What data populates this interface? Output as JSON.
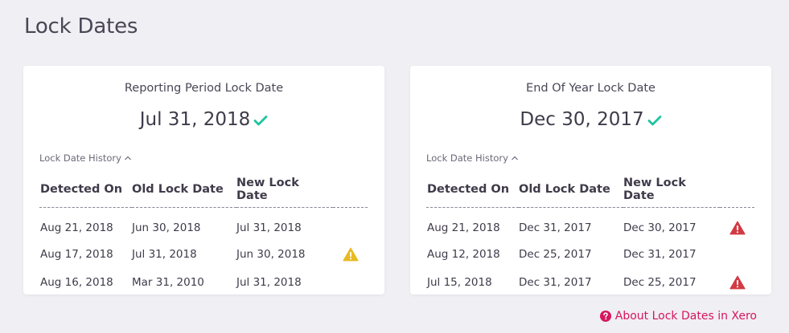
{
  "page": {
    "title": "Lock Dates"
  },
  "colors": {
    "accent": "#d6165e",
    "success": "#1ec3a0",
    "warning": "#e8b923",
    "danger": "#d23a44"
  },
  "cards": [
    {
      "title": "Reporting Period Lock Date",
      "date": "Jul 31, 2018",
      "history_label": "Lock Date History",
      "columns": [
        "Detected On",
        "Old Lock Date",
        "New Lock Date"
      ],
      "rows": [
        {
          "detected": "Aug 21, 2018",
          "old": "Jun 30, 2018",
          "new": "Jul 31, 2018",
          "icon": "none"
        },
        {
          "detected": "Aug 17, 2018",
          "old": "Jul 31, 2018",
          "new": "Jun 30, 2018",
          "icon": "warning-icon"
        },
        {
          "detected": "Aug 16, 2018",
          "old": "Mar 31, 2010",
          "new": "Jul 31, 2018",
          "icon": "none"
        }
      ]
    },
    {
      "title": "End Of Year Lock Date",
      "date": "Dec 30, 2017",
      "history_label": "Lock Date History",
      "columns": [
        "Detected On",
        "Old Lock Date",
        "New Lock Date"
      ],
      "rows": [
        {
          "detected": "Aug 21, 2018",
          "old": "Dec 31, 2017",
          "new": "Dec 30, 2017",
          "icon": "danger-icon"
        },
        {
          "detected": "Aug 12, 2018",
          "old": "Dec 25, 2017",
          "new": "Dec 31, 2017",
          "icon": "none"
        },
        {
          "detected": "Jul 15, 2018",
          "old": "Dec 31, 2017",
          "new": "Dec 25, 2017",
          "icon": "danger-icon"
        }
      ]
    }
  ],
  "footer": {
    "about_link": "About Lock Dates in Xero"
  }
}
